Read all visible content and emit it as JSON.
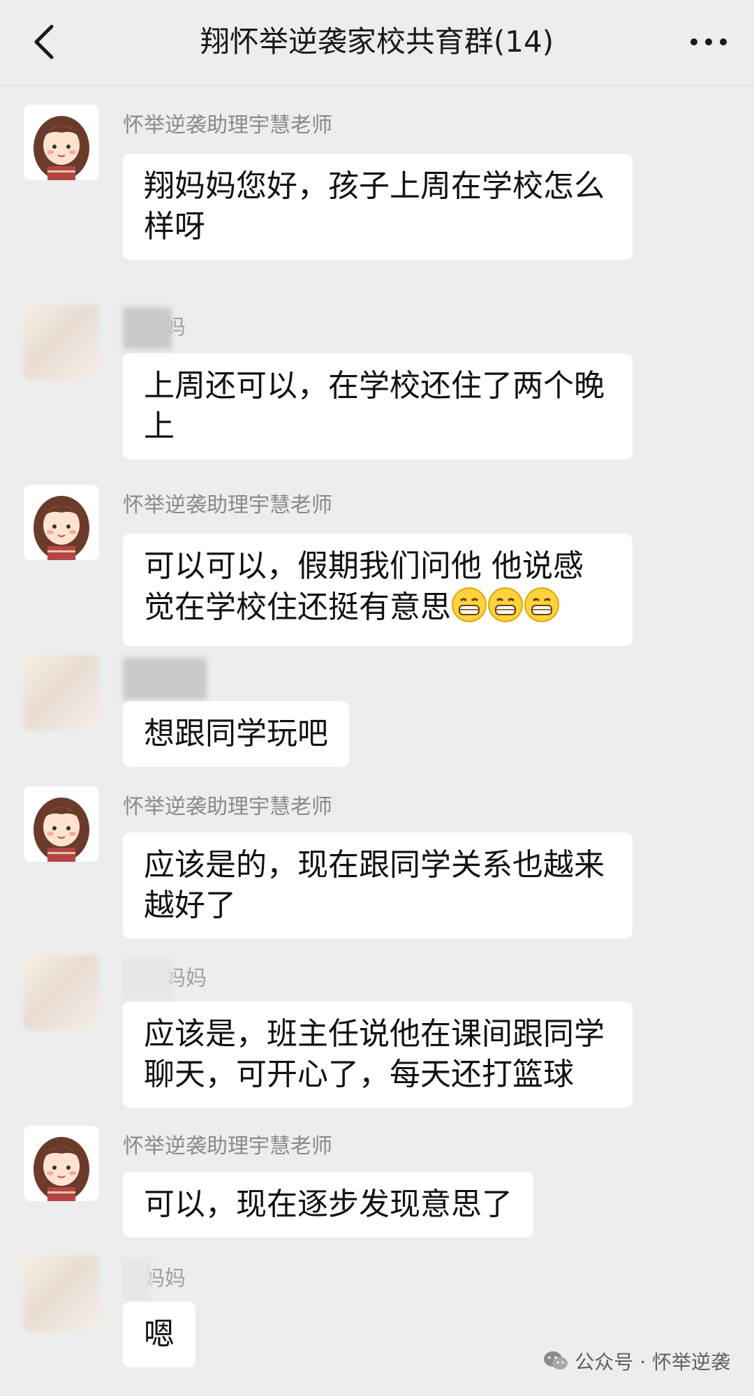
{
  "header": {
    "title": "翔怀举逆袭家校共育群(14)"
  },
  "messages": [
    {
      "sender": "怀举逆袭助理宇慧老师",
      "text": "翔妈妈您好，孩子上周在学校怎么样呀"
    },
    {
      "sender": "妈",
      "text": "上周还可以，在学校还住了两个晚上"
    },
    {
      "sender": "怀举逆袭助理宇慧老师",
      "text": "可以可以，假期我们问他 他说感觉在学校住还挺有意思"
    },
    {
      "sender": "",
      "text": "想跟同学玩吧"
    },
    {
      "sender": "怀举逆袭助理宇慧老师",
      "text": "应该是的，现在跟同学关系也越来越好了"
    },
    {
      "sender": "妈妈",
      "text": "应该是，班主任说他在课间跟同学聊天，可开心了，每天还打篮球"
    },
    {
      "sender": "怀举逆袭助理宇慧老师",
      "text": "可以，现在逐步发现意思了"
    },
    {
      "sender": "妈妈",
      "text": "嗯"
    }
  ],
  "watermark": {
    "text": "公众号 · 怀举逆袭"
  },
  "icons": {
    "back": "chevron-left-icon",
    "more": "more-horizontal-icon",
    "emoji": "grinning-face-icon",
    "wechat": "wechat-icon"
  },
  "colors": {
    "background": "#ededed",
    "bubble": "#ffffff",
    "text": "#111111",
    "nickname": "#8a8a8a"
  }
}
